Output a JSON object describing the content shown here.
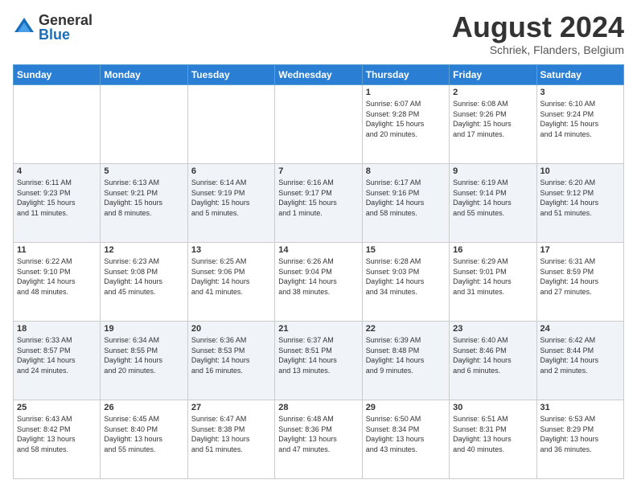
{
  "logo": {
    "general": "General",
    "blue": "Blue"
  },
  "header": {
    "month": "August 2024",
    "location": "Schriek, Flanders, Belgium"
  },
  "weekdays": [
    "Sunday",
    "Monday",
    "Tuesday",
    "Wednesday",
    "Thursday",
    "Friday",
    "Saturday"
  ],
  "weeks": [
    [
      {
        "day": "",
        "info": ""
      },
      {
        "day": "",
        "info": ""
      },
      {
        "day": "",
        "info": ""
      },
      {
        "day": "",
        "info": ""
      },
      {
        "day": "1",
        "info": "Sunrise: 6:07 AM\nSunset: 9:28 PM\nDaylight: 15 hours\nand 20 minutes."
      },
      {
        "day": "2",
        "info": "Sunrise: 6:08 AM\nSunset: 9:26 PM\nDaylight: 15 hours\nand 17 minutes."
      },
      {
        "day": "3",
        "info": "Sunrise: 6:10 AM\nSunset: 9:24 PM\nDaylight: 15 hours\nand 14 minutes."
      }
    ],
    [
      {
        "day": "4",
        "info": "Sunrise: 6:11 AM\nSunset: 9:23 PM\nDaylight: 15 hours\nand 11 minutes."
      },
      {
        "day": "5",
        "info": "Sunrise: 6:13 AM\nSunset: 9:21 PM\nDaylight: 15 hours\nand 8 minutes."
      },
      {
        "day": "6",
        "info": "Sunrise: 6:14 AM\nSunset: 9:19 PM\nDaylight: 15 hours\nand 5 minutes."
      },
      {
        "day": "7",
        "info": "Sunrise: 6:16 AM\nSunset: 9:17 PM\nDaylight: 15 hours\nand 1 minute."
      },
      {
        "day": "8",
        "info": "Sunrise: 6:17 AM\nSunset: 9:16 PM\nDaylight: 14 hours\nand 58 minutes."
      },
      {
        "day": "9",
        "info": "Sunrise: 6:19 AM\nSunset: 9:14 PM\nDaylight: 14 hours\nand 55 minutes."
      },
      {
        "day": "10",
        "info": "Sunrise: 6:20 AM\nSunset: 9:12 PM\nDaylight: 14 hours\nand 51 minutes."
      }
    ],
    [
      {
        "day": "11",
        "info": "Sunrise: 6:22 AM\nSunset: 9:10 PM\nDaylight: 14 hours\nand 48 minutes."
      },
      {
        "day": "12",
        "info": "Sunrise: 6:23 AM\nSunset: 9:08 PM\nDaylight: 14 hours\nand 45 minutes."
      },
      {
        "day": "13",
        "info": "Sunrise: 6:25 AM\nSunset: 9:06 PM\nDaylight: 14 hours\nand 41 minutes."
      },
      {
        "day": "14",
        "info": "Sunrise: 6:26 AM\nSunset: 9:04 PM\nDaylight: 14 hours\nand 38 minutes."
      },
      {
        "day": "15",
        "info": "Sunrise: 6:28 AM\nSunset: 9:03 PM\nDaylight: 14 hours\nand 34 minutes."
      },
      {
        "day": "16",
        "info": "Sunrise: 6:29 AM\nSunset: 9:01 PM\nDaylight: 14 hours\nand 31 minutes."
      },
      {
        "day": "17",
        "info": "Sunrise: 6:31 AM\nSunset: 8:59 PM\nDaylight: 14 hours\nand 27 minutes."
      }
    ],
    [
      {
        "day": "18",
        "info": "Sunrise: 6:33 AM\nSunset: 8:57 PM\nDaylight: 14 hours\nand 24 minutes."
      },
      {
        "day": "19",
        "info": "Sunrise: 6:34 AM\nSunset: 8:55 PM\nDaylight: 14 hours\nand 20 minutes."
      },
      {
        "day": "20",
        "info": "Sunrise: 6:36 AM\nSunset: 8:53 PM\nDaylight: 14 hours\nand 16 minutes."
      },
      {
        "day": "21",
        "info": "Sunrise: 6:37 AM\nSunset: 8:51 PM\nDaylight: 14 hours\nand 13 minutes."
      },
      {
        "day": "22",
        "info": "Sunrise: 6:39 AM\nSunset: 8:48 PM\nDaylight: 14 hours\nand 9 minutes."
      },
      {
        "day": "23",
        "info": "Sunrise: 6:40 AM\nSunset: 8:46 PM\nDaylight: 14 hours\nand 6 minutes."
      },
      {
        "day": "24",
        "info": "Sunrise: 6:42 AM\nSunset: 8:44 PM\nDaylight: 14 hours\nand 2 minutes."
      }
    ],
    [
      {
        "day": "25",
        "info": "Sunrise: 6:43 AM\nSunset: 8:42 PM\nDaylight: 13 hours\nand 58 minutes."
      },
      {
        "day": "26",
        "info": "Sunrise: 6:45 AM\nSunset: 8:40 PM\nDaylight: 13 hours\nand 55 minutes."
      },
      {
        "day": "27",
        "info": "Sunrise: 6:47 AM\nSunset: 8:38 PM\nDaylight: 13 hours\nand 51 minutes."
      },
      {
        "day": "28",
        "info": "Sunrise: 6:48 AM\nSunset: 8:36 PM\nDaylight: 13 hours\nand 47 minutes."
      },
      {
        "day": "29",
        "info": "Sunrise: 6:50 AM\nSunset: 8:34 PM\nDaylight: 13 hours\nand 43 minutes."
      },
      {
        "day": "30",
        "info": "Sunrise: 6:51 AM\nSunset: 8:31 PM\nDaylight: 13 hours\nand 40 minutes."
      },
      {
        "day": "31",
        "info": "Sunrise: 6:53 AM\nSunset: 8:29 PM\nDaylight: 13 hours\nand 36 minutes."
      }
    ]
  ]
}
